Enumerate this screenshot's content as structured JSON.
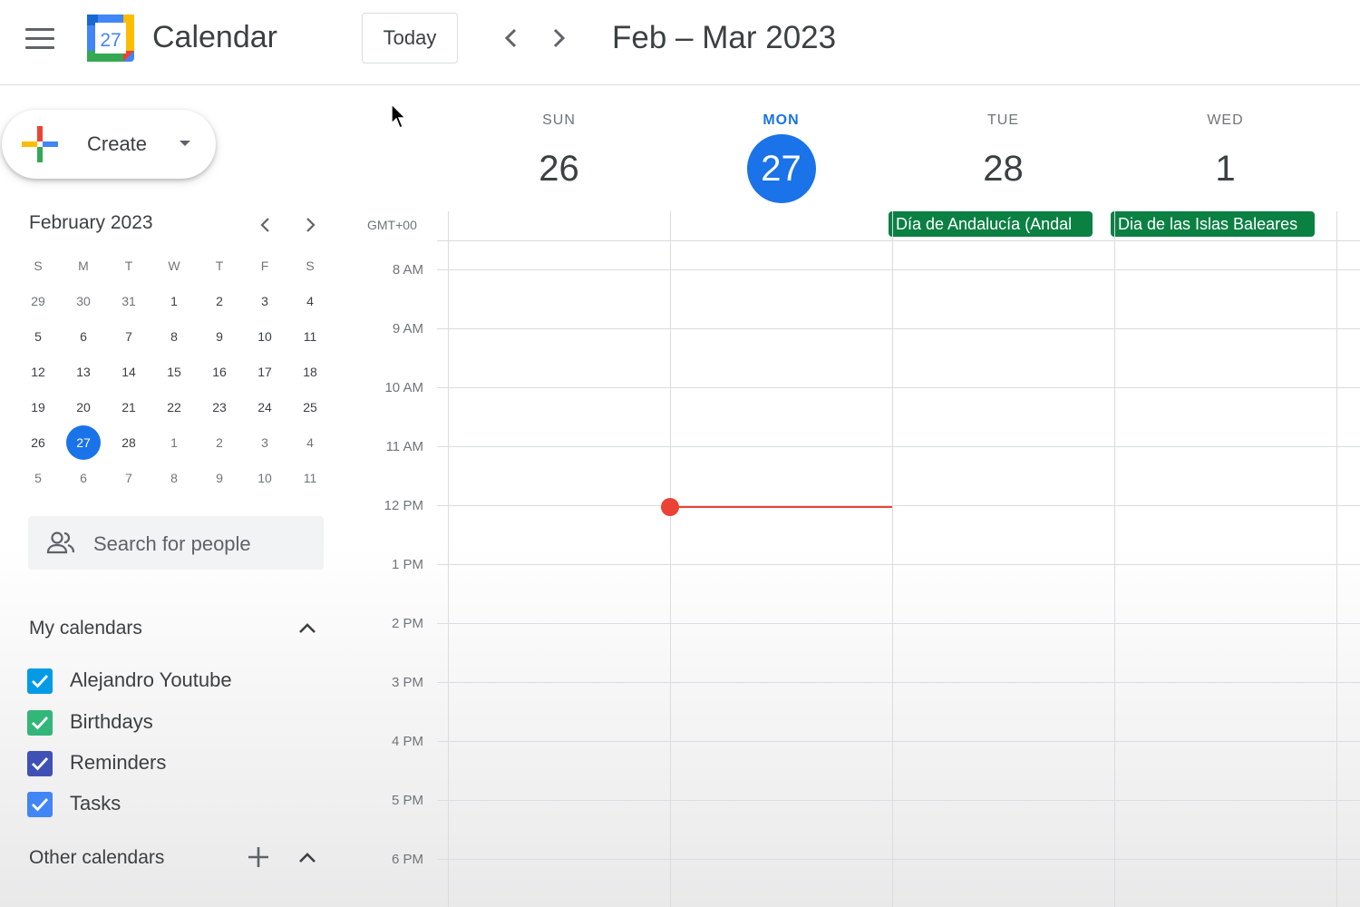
{
  "header": {
    "app_title": "Calendar",
    "logo_day": "27",
    "today_label": "Today",
    "range_title": "Feb – Mar 2023"
  },
  "sidebar": {
    "create_label": "Create",
    "mini_calendar": {
      "title": "February 2023",
      "weekdays": [
        "S",
        "M",
        "T",
        "W",
        "T",
        "F",
        "S"
      ],
      "weeks": [
        [
          "29",
          "30",
          "31",
          "1",
          "2",
          "3",
          "4"
        ],
        [
          "5",
          "6",
          "7",
          "8",
          "9",
          "10",
          "11"
        ],
        [
          "12",
          "13",
          "14",
          "15",
          "16",
          "17",
          "18"
        ],
        [
          "19",
          "20",
          "21",
          "22",
          "23",
          "24",
          "25"
        ],
        [
          "26",
          "27",
          "28",
          "1",
          "2",
          "3",
          "4"
        ],
        [
          "5",
          "6",
          "7",
          "8",
          "9",
          "10",
          "11"
        ]
      ],
      "selected": "27"
    },
    "search_placeholder": "Search for people",
    "my_calendars_title": "My calendars",
    "my_calendars": [
      {
        "label": "Alejandro Youtube",
        "color": "#039be5"
      },
      {
        "label": "Birthdays",
        "color": "#33b679"
      },
      {
        "label": "Reminders",
        "color": "#3f51b5"
      },
      {
        "label": "Tasks",
        "color": "#4285f4"
      }
    ],
    "other_calendars_title": "Other calendars"
  },
  "main": {
    "timezone": "GMT+00",
    "days": [
      {
        "name": "SUN",
        "number": "26",
        "today": false
      },
      {
        "name": "MON",
        "number": "27",
        "today": true
      },
      {
        "name": "TUE",
        "number": "28",
        "today": false
      },
      {
        "name": "WED",
        "number": "1",
        "today": false
      }
    ],
    "all_day_events": [
      {
        "title": "Día de Andalucía (Andal",
        "day": "TUE",
        "color": "#0b8043"
      },
      {
        "title": "Dia de las Islas Baleares",
        "day": "WED",
        "color": "#0b8043"
      }
    ],
    "hours": [
      "8 AM",
      "9 AM",
      "10 AM",
      "11 AM",
      "12 PM",
      "1 PM",
      "2 PM",
      "3 PM",
      "4 PM",
      "5 PM",
      "6 PM"
    ]
  },
  "colors": {
    "accent": "#1a73e8",
    "now_indicator": "#ea4335"
  }
}
